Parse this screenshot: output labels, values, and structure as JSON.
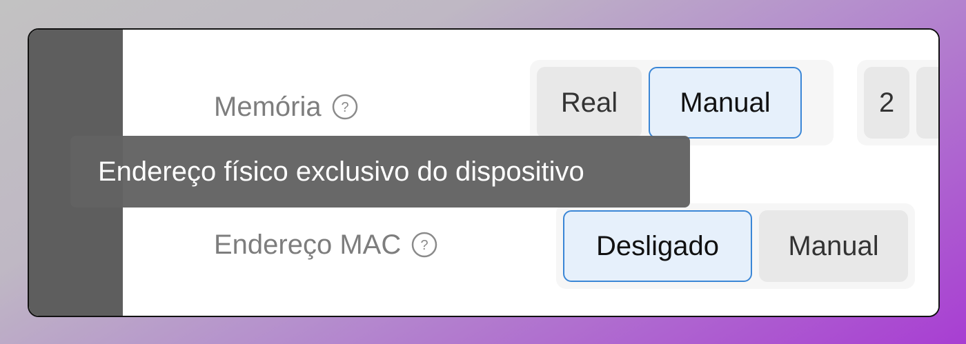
{
  "settings": {
    "memory": {
      "label": "Memória",
      "options": [
        "Real",
        "Manual"
      ],
      "selected": "Manual",
      "value": "2"
    },
    "mac": {
      "label": "Endereço MAC",
      "options": [
        "Desligado",
        "Manual"
      ],
      "selected": "Desligado"
    }
  },
  "tooltip": {
    "text": "Endereço físico exclusivo do dispositivo"
  },
  "colors": {
    "accent": "#3a86d6",
    "selected_bg": "#e6f0fb",
    "tooltip_bg": "#626262",
    "sidebar_bg": "#5e5e5e"
  }
}
